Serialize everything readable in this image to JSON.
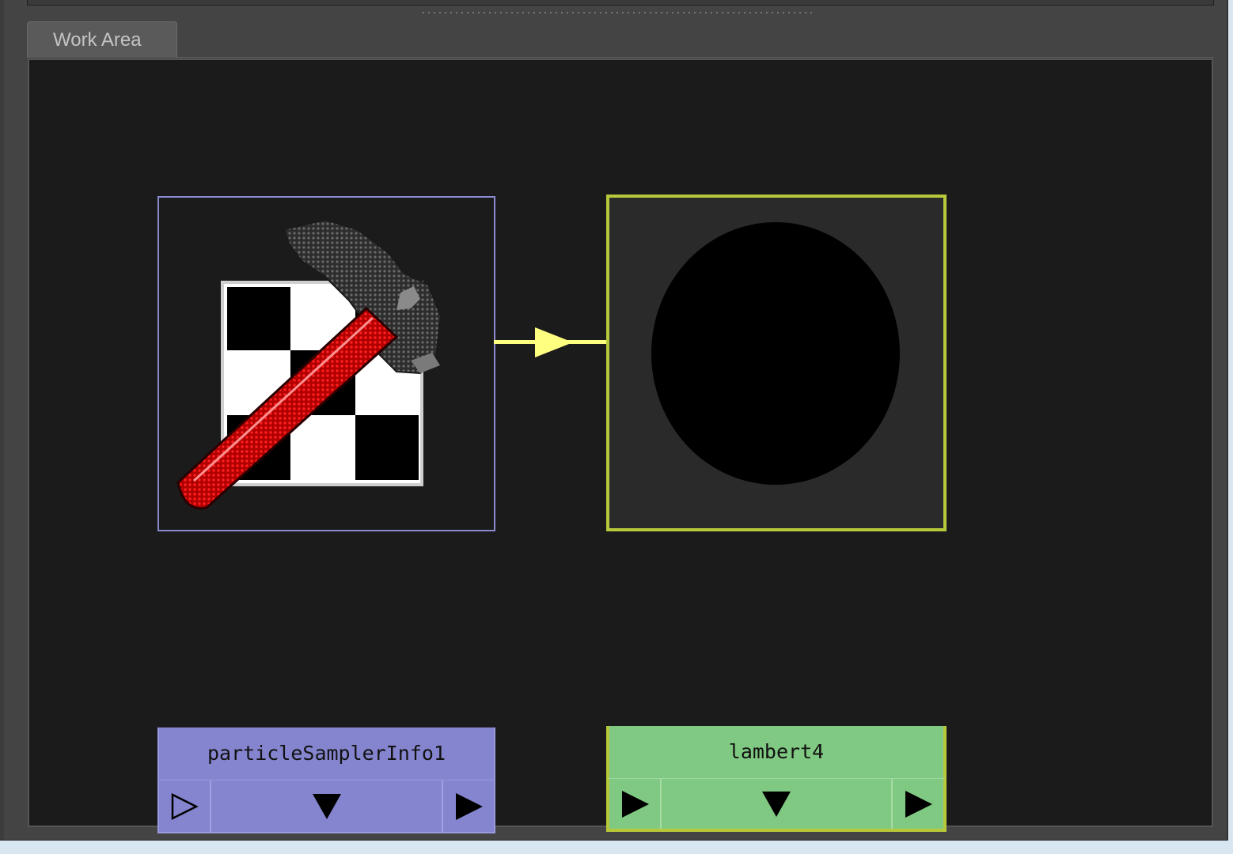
{
  "panel": {
    "tabs": [
      {
        "label": "Work Area",
        "active": true
      }
    ]
  },
  "nodes": [
    {
      "name": "particleSamplerInfo1",
      "color": "#8585cf",
      "icon": "particle-sampler-icon",
      "selected": false
    },
    {
      "name": "lambert4",
      "color": "#80c982",
      "border_color": "#b7c93a",
      "icon": "shader-sphere-icon",
      "selected": true
    }
  ],
  "connection": {
    "color": "#ffff80",
    "from": "particleSamplerInfo1",
    "to": "lambert4"
  }
}
